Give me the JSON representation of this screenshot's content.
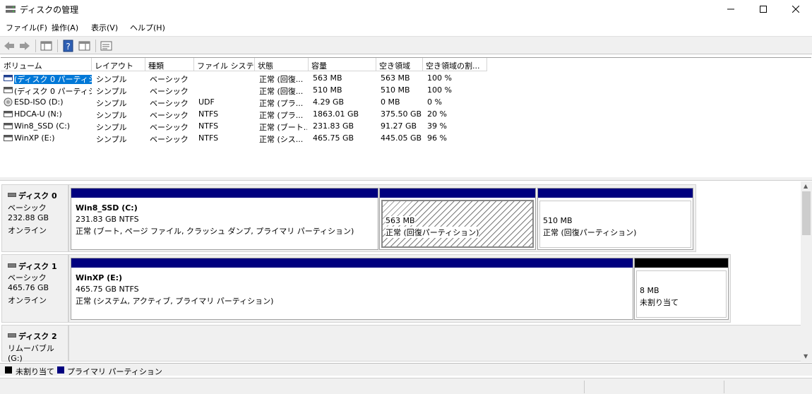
{
  "window": {
    "title": "ディスクの管理"
  },
  "menu": [
    "ファイル(F)",
    "操作(A)",
    "表示(V)",
    "ヘルプ(H)"
  ],
  "columns": [
    "ボリューム",
    "レイアウト",
    "種類",
    "ファイル システム",
    "状態",
    "容量",
    "空き領域",
    "空き領域の割..."
  ],
  "volumes": [
    [
      "(ディスク 0 パーティシ...",
      "シンプル",
      "ベーシック",
      "",
      "正常 (回復...",
      "563 MB",
      "563 MB",
      "100 %"
    ],
    [
      "(ディスク 0 パーティシ...",
      "シンプル",
      "ベーシック",
      "",
      "正常 (回復...",
      "510 MB",
      "510 MB",
      "100 %"
    ],
    [
      "ESD-ISO (D:)",
      "シンプル",
      "ベーシック",
      "UDF",
      "正常 (プラ...",
      "4.29 GB",
      "0 MB",
      "0 %"
    ],
    [
      "HDCA-U (N:)",
      "シンプル",
      "ベーシック",
      "NTFS",
      "正常 (プラ...",
      "1863.01 GB",
      "375.50 GB",
      "20 %"
    ],
    [
      "Win8_SSD (C:)",
      "シンプル",
      "ベーシック",
      "NTFS",
      "正常 (ブート...",
      "231.83 GB",
      "91.27 GB",
      "39 %"
    ],
    [
      "WinXP (E:)",
      "シンプル",
      "ベーシック",
      "NTFS",
      "正常 (シス...",
      "465.75 GB",
      "445.05 GB",
      "96 %"
    ]
  ],
  "disks": [
    {
      "name": "ディスク 0",
      "type": "ベーシック",
      "size": "232.88 GB",
      "status": "オンライン",
      "partitions": [
        {
          "name": "Win8_SSD  (C:)",
          "size": "231.83 GB NTFS",
          "status": "正常 (ブート, ページ ファイル, クラッシュ ダンプ, プライマリ パーティション)"
        },
        {
          "name": "",
          "size": "563 MB",
          "status": "正常 (回復パーティション)"
        },
        {
          "name": "",
          "size": "510 MB",
          "status": "正常 (回復パーティション)"
        }
      ]
    },
    {
      "name": "ディスク 1",
      "type": "ベーシック",
      "size": "465.76 GB",
      "status": "オンライン",
      "partitions": [
        {
          "name": "WinXP  (E:)",
          "size": "465.75 GB NTFS",
          "status": "正常 (システム, アクティブ, プライマリ パーティション)"
        },
        {
          "name": "",
          "size": "8 MB",
          "status": "未割り当て"
        }
      ]
    },
    {
      "name": "ディスク 2",
      "type": "リムーバブル (G:)"
    }
  ],
  "legend": [
    "未割り当て",
    "プライマリ パーティション"
  ],
  "colors": {
    "primary": "#00007f",
    "unallocated": "#000000",
    "selection": "#0078d7"
  }
}
